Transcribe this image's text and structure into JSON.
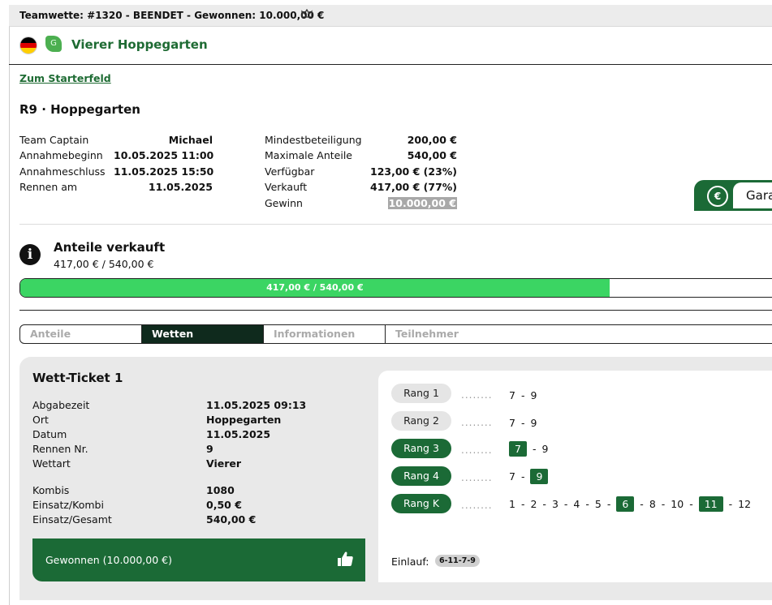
{
  "topbar": {
    "text": "Teamwette: #1320 - BEENDET - Gewonnen: 10.000,00 €",
    "crown_icon": "crown-icon"
  },
  "race": {
    "name": "Vierer Hoppegarten",
    "flag_icon": "flag-germany-icon",
    "badge": "G",
    "starterfeld_link": "Zum Starterfeld",
    "title": "R9 · Hoppegarten"
  },
  "details_left": [
    {
      "label": "Team Captain",
      "value": "Michael"
    },
    {
      "label": "Annahmebeginn",
      "value": "10.05.2025 11:00"
    },
    {
      "label": "Annahmeschluss",
      "value": "11.05.2025 15:50"
    },
    {
      "label": "Rennen am",
      "value": "11.05.2025"
    }
  ],
  "details_right": [
    {
      "label": "Mindestbeteiligung",
      "value": "200,00 €"
    },
    {
      "label": "Maximale Anteile",
      "value": "540,00 €"
    },
    {
      "label": "Verfügbar",
      "value": "123,00 € (23%)"
    },
    {
      "label": "Verkauft",
      "value": "417,00 € (77%)"
    },
    {
      "label": "Gewinn",
      "value": "10.000,00 €"
    }
  ],
  "garantie": {
    "label": "Gara",
    "icon": "money-bag-icon"
  },
  "anteile": {
    "title": "Anteile verkauft",
    "subtitle": "417,00 € / 540,00 €",
    "progress_label": "417,00 € / 540,00 €",
    "progress_fraction": 0.772
  },
  "tabs": [
    {
      "label": "Anteile",
      "active": false
    },
    {
      "label": "Wetten",
      "active": true
    },
    {
      "label": "Informationen",
      "active": false
    },
    {
      "label": "Teilnehmer",
      "active": false
    }
  ],
  "ticket": {
    "title": "Wett-Ticket 1",
    "rows": [
      {
        "label": "Abgabezeit",
        "value": "11.05.2025 09:13"
      },
      {
        "label": "Ort",
        "value": "Hoppegarten"
      },
      {
        "label": "Datum",
        "value": "11.05.2025"
      },
      {
        "label": "Rennen Nr.",
        "value": "9"
      },
      {
        "label": "Wettart",
        "value": "Vierer"
      }
    ],
    "rows2": [
      {
        "label": "Kombis",
        "value": "1080"
      },
      {
        "label": "Einsatz/Kombi",
        "value": "0,50 €"
      },
      {
        "label": "Einsatz/Gesamt",
        "value": "540,00 €"
      }
    ],
    "won_label": "Gewonnen (10.000,00 €)",
    "won_icon": "thumbs-up-icon"
  },
  "rangs": [
    {
      "label": "Rang 1",
      "active": false,
      "numbers": [
        {
          "v": "7",
          "hl": false
        },
        {
          "v": "9",
          "hl": false
        }
      ]
    },
    {
      "label": "Rang 2",
      "active": false,
      "numbers": [
        {
          "v": "7",
          "hl": false
        },
        {
          "v": "9",
          "hl": false
        }
      ]
    },
    {
      "label": "Rang 3",
      "active": true,
      "numbers": [
        {
          "v": "7",
          "hl": true
        },
        {
          "v": "9",
          "hl": false
        }
      ]
    },
    {
      "label": "Rang 4",
      "active": true,
      "numbers": [
        {
          "v": "7",
          "hl": false
        },
        {
          "v": "9",
          "hl": true
        }
      ]
    },
    {
      "label": "Rang K",
      "active": true,
      "numbers": [
        {
          "v": "1",
          "hl": false
        },
        {
          "v": "2",
          "hl": false
        },
        {
          "v": "3",
          "hl": false
        },
        {
          "v": "4",
          "hl": false
        },
        {
          "v": "5",
          "hl": false
        },
        {
          "v": "6",
          "hl": true
        },
        {
          "v": "8",
          "hl": false
        },
        {
          "v": "10",
          "hl": false
        },
        {
          "v": "11",
          "hl": true
        },
        {
          "v": "12",
          "hl": false
        }
      ]
    }
  ],
  "dots_text": "........",
  "einlauf": {
    "label": "Einlauf:",
    "value": "6-11-7-9"
  }
}
